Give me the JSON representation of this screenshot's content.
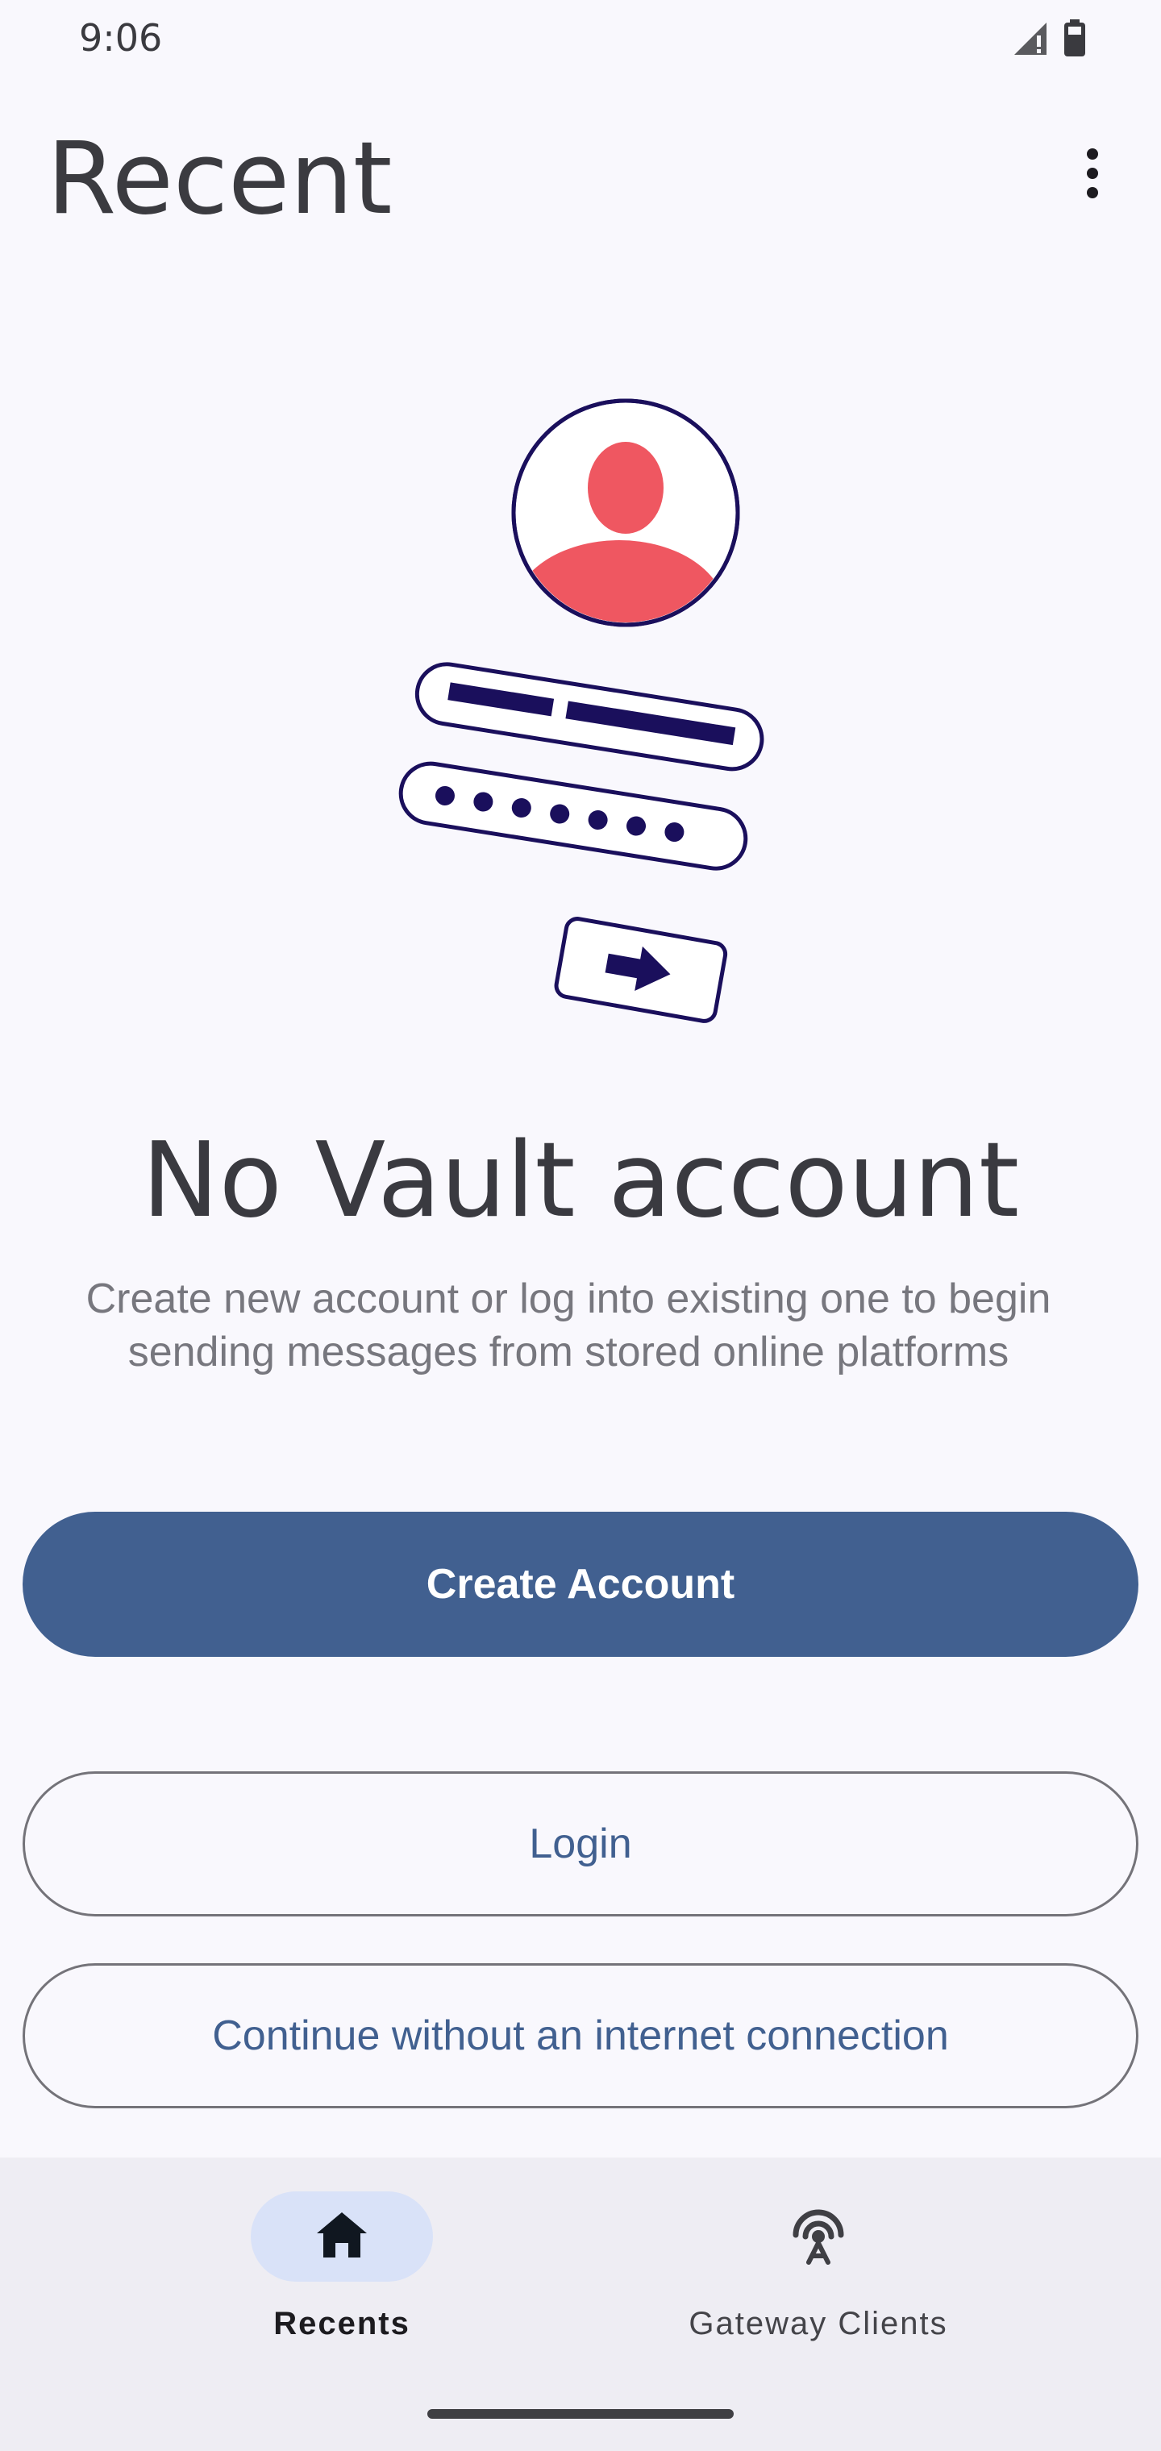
{
  "status_bar": {
    "time": "9:06",
    "icons": [
      "signal-icon",
      "battery-icon"
    ]
  },
  "header": {
    "title": "Recent",
    "menu_icon": "more-vert-icon"
  },
  "empty_state": {
    "illustration": "vault-login-illustration",
    "title": "No Vault account",
    "description": "Create new account or log into existing one to begin sending messages from stored online platforms"
  },
  "actions": {
    "create_account": "Create Account",
    "login": "Login",
    "offline": "Continue without an internet connection"
  },
  "bottom_nav": {
    "items": [
      {
        "label": "Recents",
        "icon": "home-icon",
        "selected": true
      },
      {
        "label": "Gateway Clients",
        "icon": "antenna-icon",
        "selected": false
      }
    ]
  },
  "colors": {
    "background": "#f9f8fd",
    "primary": "#416090",
    "nav_background": "#eeedf3",
    "nav_selected": "#d9e2f8",
    "illustration_accent": "#ef5761",
    "illustration_ink": "#1a0f5c"
  }
}
